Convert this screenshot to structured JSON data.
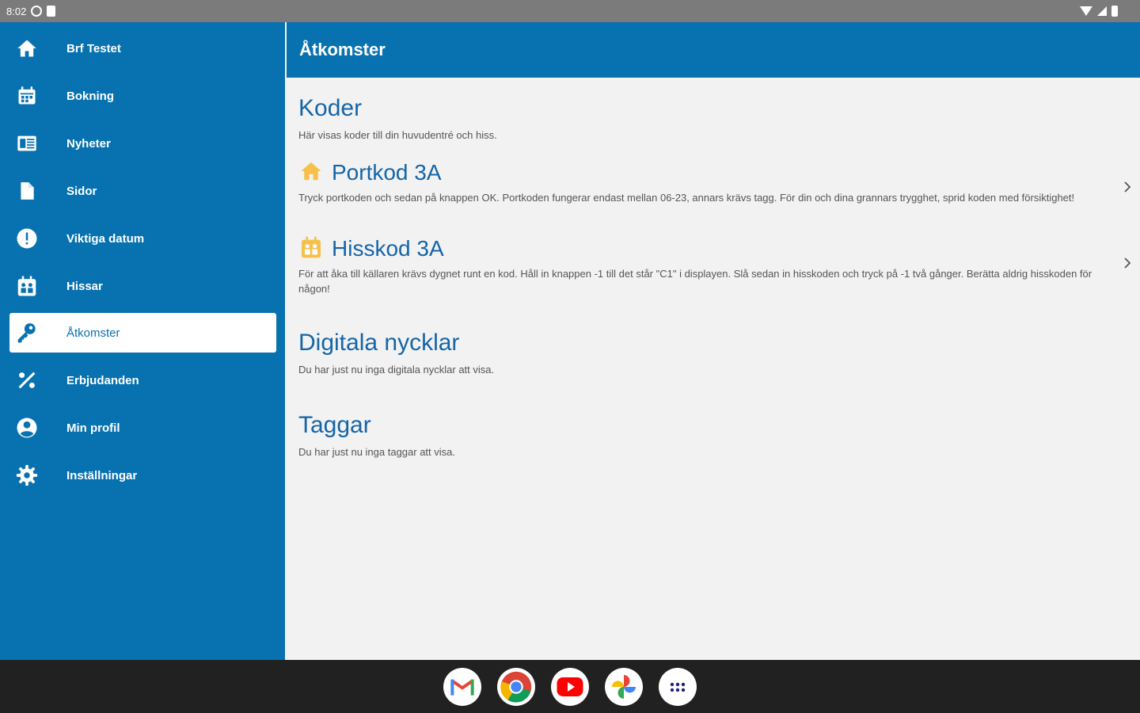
{
  "status_bar": {
    "time": "8:02"
  },
  "header": {
    "title": "Åtkomster"
  },
  "sidebar": {
    "items": [
      {
        "label": "Brf Testet",
        "icon": "home-icon"
      },
      {
        "label": "Bokning",
        "icon": "calendar-icon"
      },
      {
        "label": "Nyheter",
        "icon": "newspaper-icon"
      },
      {
        "label": "Sidor",
        "icon": "document-icon"
      },
      {
        "label": "Viktiga datum",
        "icon": "alert-circle-icon"
      },
      {
        "label": "Hissar",
        "icon": "elevator-icon"
      },
      {
        "label": "Åtkomster",
        "icon": "key-icon",
        "active": true
      },
      {
        "label": "Erbjudanden",
        "icon": "percent-icon"
      },
      {
        "label": "Min profil",
        "icon": "account-icon"
      },
      {
        "label": "Inställningar",
        "icon": "gear-icon"
      }
    ]
  },
  "main": {
    "koder": {
      "title": "Koder",
      "subtitle": "Här visas koder till din huvudentré och hiss.",
      "items": [
        {
          "title": "Portkod 3A",
          "icon": "home-icon",
          "description": "Tryck portkoden och sedan på knappen OK. Portkoden fungerar endast mellan 06-23, annars krävs tagg. För din och dina grannars trygghet, sprid koden med försiktighet!"
        },
        {
          "title": "Hisskod 3A",
          "icon": "elevator-icon",
          "description": "För att åka till källaren krävs dygnet runt en kod. Håll in knappen -1 till det står \"C1\" i displayen. Slå sedan in hisskoden och tryck på -1 två gånger. Berätta aldrig hisskoden för någon!"
        }
      ]
    },
    "digitala": {
      "title": "Digitala nycklar",
      "subtitle": "Du har just nu inga digitala nycklar att visa."
    },
    "taggar": {
      "title": "Taggar",
      "subtitle": "Du har just nu inga taggar att visa."
    }
  },
  "taskbar": {
    "apps": [
      "gmail-icon",
      "chrome-icon",
      "youtube-icon",
      "photos-icon",
      "app-drawer-icon"
    ]
  },
  "colors": {
    "primary": "#0872b0",
    "title_blue": "#1565a8",
    "accent_yellow": "#f7c04a"
  }
}
